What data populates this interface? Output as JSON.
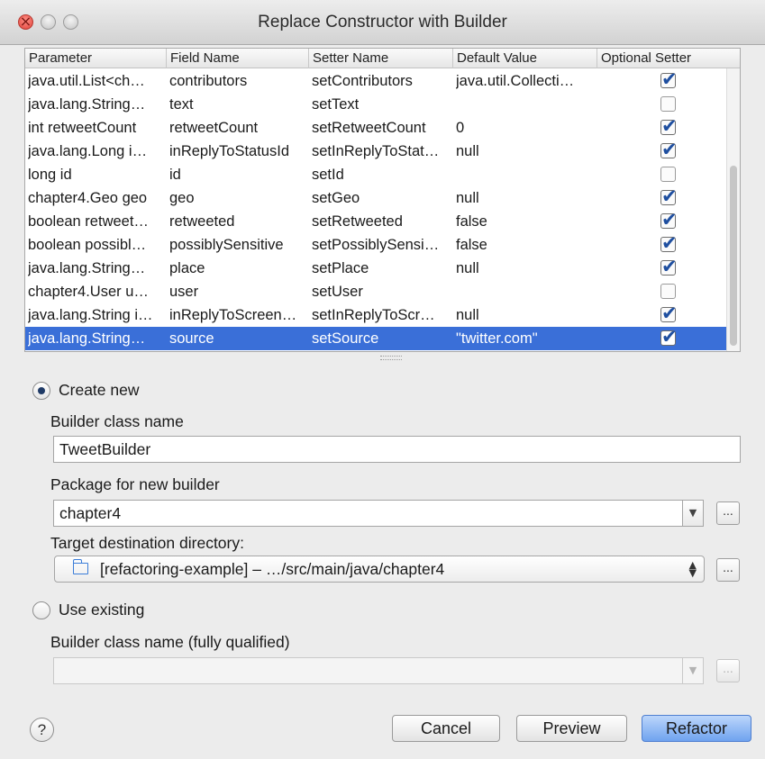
{
  "window": {
    "title": "Replace Constructor with Builder"
  },
  "table": {
    "headers": [
      "Parameter",
      "Field Name",
      "Setter Name",
      "Default Value",
      "Optional Setter"
    ],
    "rows": [
      {
        "param": "java.util.List<ch…",
        "field": "contributors",
        "setter": "setContributors",
        "default": "java.util.Collecti…",
        "optional": true
      },
      {
        "param": "java.lang.String…",
        "field": "text",
        "setter": "setText",
        "default": "",
        "optional": false
      },
      {
        "param": "int retweetCount",
        "field": "retweetCount",
        "setter": "setRetweetCount",
        "default": "0",
        "optional": true
      },
      {
        "param": "java.lang.Long i…",
        "field": "inReplyToStatusId",
        "setter": "setInReplyToStat…",
        "default": "null",
        "optional": true
      },
      {
        "param": "long id",
        "field": "id",
        "setter": "setId",
        "default": "",
        "optional": false
      },
      {
        "param": "chapter4.Geo geo",
        "field": "geo",
        "setter": "setGeo",
        "default": "null",
        "optional": true
      },
      {
        "param": "boolean retweet…",
        "field": "retweeted",
        "setter": "setRetweeted",
        "default": "false",
        "optional": true
      },
      {
        "param": "boolean possibl…",
        "field": "possiblySensitive",
        "setter": "setPossiblySensi…",
        "default": "false",
        "optional": true
      },
      {
        "param": "java.lang.String…",
        "field": "place",
        "setter": "setPlace",
        "default": "null",
        "optional": true
      },
      {
        "param": "chapter4.User u…",
        "field": "user",
        "setter": "setUser",
        "default": "",
        "optional": false
      },
      {
        "param": "java.lang.String i…",
        "field": "inReplyToScreen…",
        "setter": "setInReplyToScr…",
        "default": "null",
        "optional": true
      },
      {
        "param": "java.lang.String…",
        "field": "source",
        "setter": "setSource",
        "default": "\"twitter.com\"",
        "optional": true,
        "selected": true
      }
    ]
  },
  "create_new": {
    "label": "Create new",
    "selected": true,
    "builder_class_label": "Builder class name",
    "builder_class_value": "TweetBuilder",
    "package_label": "Package for new builder",
    "package_value": "chapter4",
    "target_label": "Target destination directory:",
    "target_value": "[refactoring-example] – …/src/main/java/chapter4"
  },
  "use_existing": {
    "label": "Use existing",
    "selected": false,
    "fq_label": "Builder class name (fully qualified)",
    "fq_value": ""
  },
  "buttons": {
    "help": "?",
    "cancel": "Cancel",
    "preview": "Preview",
    "refactor": "Refactor",
    "browse": "..."
  },
  "colors": {
    "selection": "#3a6fd8",
    "default_button": "#6fa3ef"
  }
}
